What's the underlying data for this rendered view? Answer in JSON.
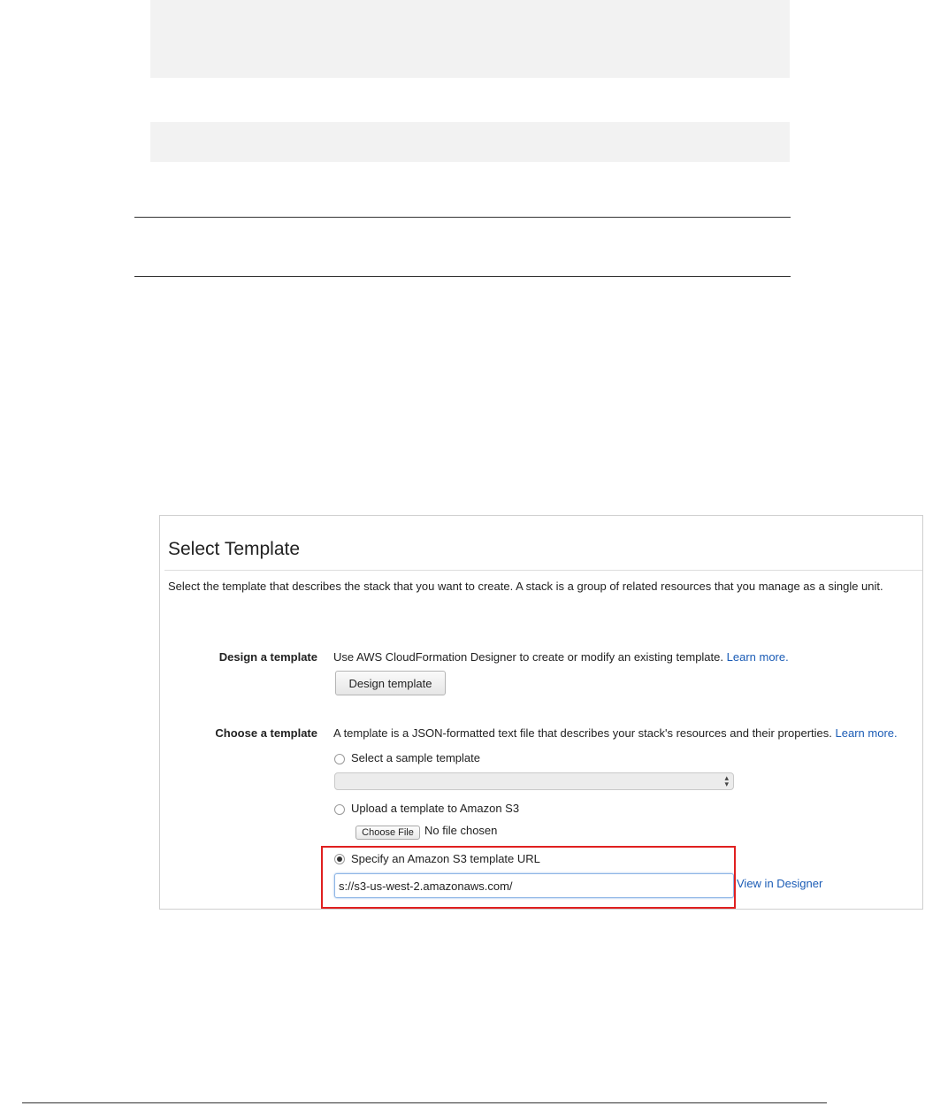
{
  "panel": {
    "title": "Select Template",
    "description": "Select the template that describes the stack that you want to create. A stack is a group of related resources that you manage as a single unit."
  },
  "design": {
    "label": "Design a template",
    "text": "Use AWS CloudFormation Designer to create or modify an existing template.",
    "learn_more": "Learn more.",
    "button": "Design template"
  },
  "choose": {
    "label": "Choose a template",
    "text": "A template is a JSON-formatted text file that describes your stack's resources and their properties.",
    "learn_more": "Learn more.",
    "option_sample": "Select a sample template",
    "sample_selected": "",
    "option_upload": "Upload a template to Amazon S3",
    "choose_file": "Choose File",
    "no_file": "No file chosen",
    "option_url": "Specify an Amazon S3 template URL",
    "url_value": "s://s3-us-west-2.amazonaws.com/",
    "view_designer": "View in Designer"
  },
  "colors": {
    "link": "#1a5bb5",
    "highlight": "#e02020"
  }
}
